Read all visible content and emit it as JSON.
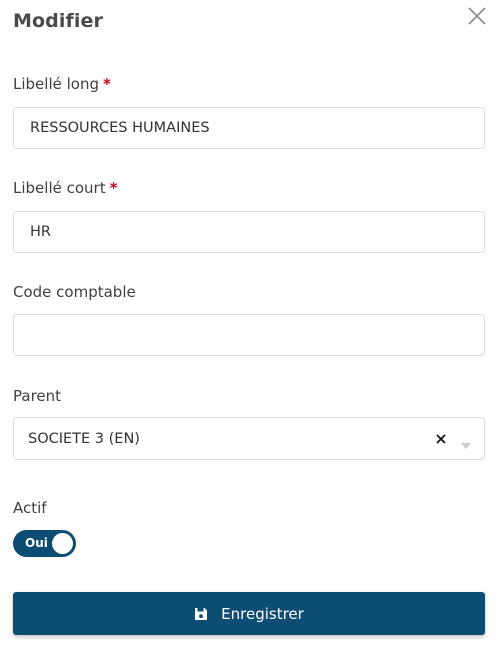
{
  "dialog": {
    "title": "Modifier"
  },
  "fields": {
    "libelle_long": {
      "label": "Libellé long",
      "required_mark": "*",
      "value": "RESSOURCES HUMAINES"
    },
    "libelle_court": {
      "label": "Libellé court",
      "required_mark": "*",
      "value": "HR"
    },
    "code_comptable": {
      "label": "Code comptable",
      "value": ""
    },
    "parent": {
      "label": "Parent",
      "value": "SOCIETE 3 (EN)"
    },
    "actif": {
      "label": "Actif",
      "toggle_text": "Oui",
      "checked": true
    }
  },
  "actions": {
    "save_label": "Enregistrer"
  },
  "colors": {
    "primary": "#0e4d73",
    "required": "#d0021b",
    "border": "#dcdcdc"
  },
  "icons": {
    "close": "close-icon",
    "save": "floppy-disk-icon",
    "clear": "clear-x-icon",
    "dropdown": "caret-down-icon"
  }
}
